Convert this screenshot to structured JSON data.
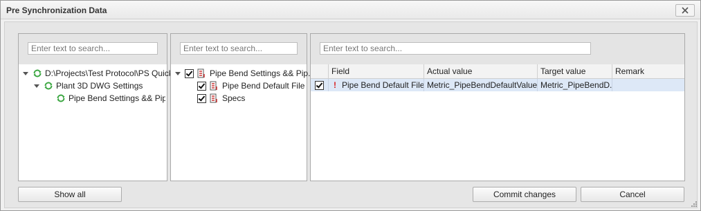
{
  "window": {
    "title": "Pre Synchronization Data"
  },
  "search": {
    "placeholder": "Enter text to search..."
  },
  "left_tree": {
    "items": [
      {
        "label": "D:\\Projects\\Test Protocol\\PS Quick - T"
      },
      {
        "label": "Plant 3D DWG Settings"
      },
      {
        "label": "Pipe Bend Settings && Pipe Sp"
      }
    ]
  },
  "middle_tree": {
    "items": [
      {
        "label": "Pipe Bend Settings && Pip..."
      },
      {
        "label": "Pipe Bend Default File"
      },
      {
        "label": "Specs"
      }
    ]
  },
  "grid": {
    "columns": [
      "Field",
      "Actual value",
      "Target value",
      "Remark"
    ],
    "rows": [
      {
        "field": "Pipe Bend Default File",
        "actual": "Metric_PipeBendDefaultValues...",
        "target": "Metric_PipeBendD...",
        "remark": "",
        "warning": "!"
      }
    ]
  },
  "buttons": {
    "show_all": "Show all",
    "commit": "Commit changes",
    "cancel": "Cancel"
  },
  "colors": {
    "accent_row": "#dde8f7",
    "sync_green": "#3aa640",
    "warning_red": "#d81e1e"
  }
}
